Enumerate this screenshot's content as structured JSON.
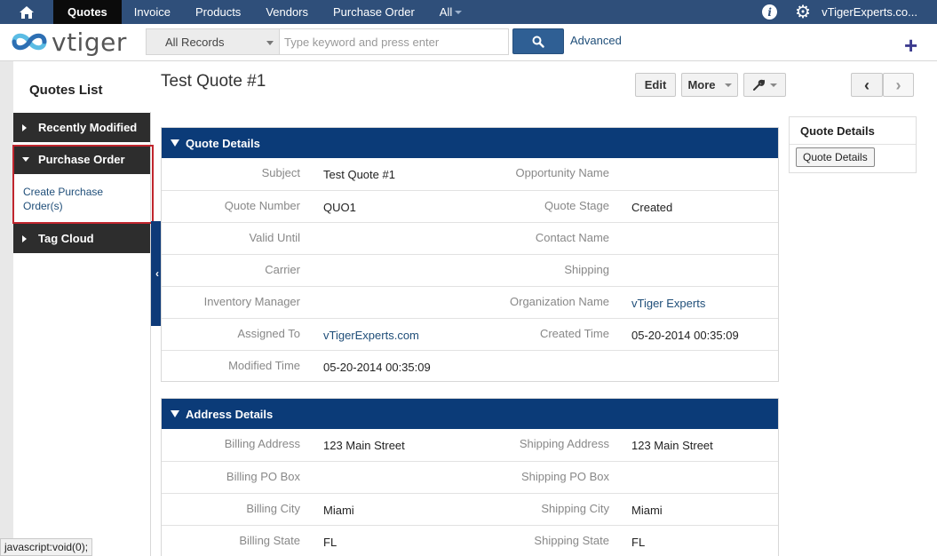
{
  "topnav": {
    "items": [
      "Quotes",
      "Invoice",
      "Products",
      "Vendors",
      "Purchase Order",
      "All"
    ],
    "active": "Quotes",
    "user": "vTigerExperts.co..."
  },
  "header": {
    "logo_text": "vtiger",
    "filter_value": "All Records",
    "search_placeholder": "Type keyword and press enter",
    "advanced_label": "Advanced",
    "plus_label": "+"
  },
  "sidebar": {
    "title": "Quotes List",
    "sections": [
      {
        "label": "Recently Modified",
        "expanded": false
      },
      {
        "label": "Purchase Order",
        "expanded": true
      },
      {
        "label": "Tag Cloud",
        "expanded": false
      }
    ],
    "link": "Create Purchase Order(s)"
  },
  "record": {
    "title": "Test Quote #1",
    "buttons": {
      "edit": "Edit",
      "more": "More"
    }
  },
  "quote_details": {
    "header": "Quote Details",
    "rows": [
      {
        "l1": "Subject",
        "v1": "Test Quote #1",
        "l2": "Opportunity Name",
        "v2": ""
      },
      {
        "l1": "Quote Number",
        "v1": "QUO1",
        "l2": "Quote Stage",
        "v2": "Created"
      },
      {
        "l1": "Valid Until",
        "v1": "",
        "l2": "Contact Name",
        "v2": ""
      },
      {
        "l1": "Carrier",
        "v1": "",
        "l2": "Shipping",
        "v2": ""
      },
      {
        "l1": "Inventory Manager",
        "v1": "",
        "l2": "Organization Name",
        "v2": "vTiger Experts"
      },
      {
        "l1": "Assigned To",
        "v1": "vTigerExperts.com",
        "l2": "Created Time",
        "v2": "05-20-2014 00:35:09"
      },
      {
        "l1": "Modified Time",
        "v1": "05-20-2014 00:35:09",
        "l2": "",
        "v2": ""
      }
    ]
  },
  "address_details": {
    "header": "Address Details",
    "rows": [
      {
        "l1": "Billing Address",
        "v1": "123 Main Street",
        "l2": "Shipping Address",
        "v2": "123 Main Street"
      },
      {
        "l1": "Billing PO Box",
        "v1": "",
        "l2": "Shipping PO Box",
        "v2": ""
      },
      {
        "l1": "Billing City",
        "v1": "Miami",
        "l2": "Shipping City",
        "v2": "Miami"
      },
      {
        "l1": "Billing State",
        "v1": "FL",
        "l2": "Shipping State",
        "v2": "FL"
      }
    ]
  },
  "right_panel": {
    "title": "Quote Details",
    "button": "Quote Details"
  },
  "statusbar": "javascript:void(0);",
  "colors": {
    "topnav": "#2f4f7a",
    "block_header": "#0b3b78",
    "link": "#1f4e79",
    "highlight": "#c0262e"
  }
}
